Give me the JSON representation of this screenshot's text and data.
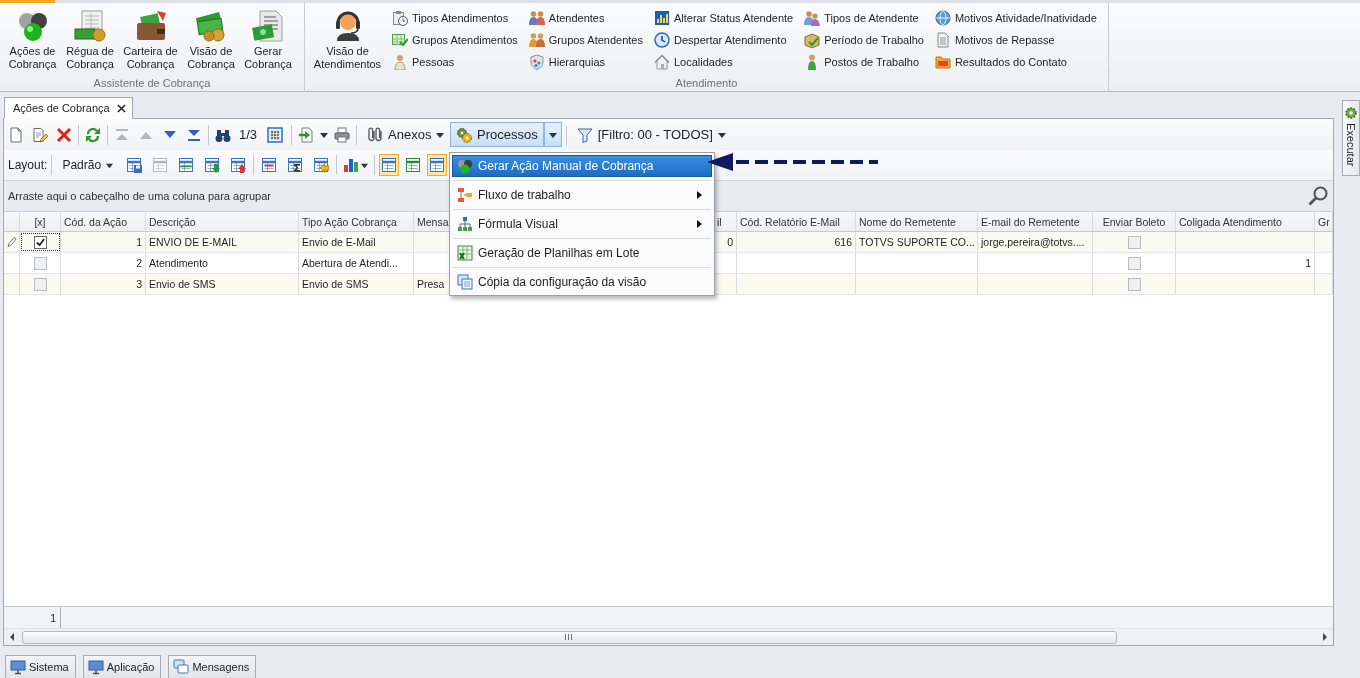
{
  "ribbon": {
    "groups": [
      {
        "label": "Assistente de Cobrança",
        "large_buttons": [
          "Ações de Cobrança",
          "Régua de Cobrança",
          "Carteira de Cobrança",
          "Visão de Cobrança",
          "Gerar Cobrança"
        ]
      },
      {
        "label": "Atendimento",
        "large_buttons": [
          "Visão de Atendimentos"
        ],
        "small_button_columns": [
          [
            "Tipos Atendimentos",
            "Grupos Atendimentos",
            "Pessoas"
          ],
          [
            "Atendentes",
            "Grupos Atendentes",
            "Hierarquias"
          ],
          [
            "Alterar Status Atendente",
            "Despertar Atendimento",
            "Localidades"
          ],
          [
            "Tipos de Atendente",
            "Período de Trabalho",
            "Postos de Trabalho"
          ],
          [
            "Motivos Atividade/Inatividade",
            "Motivos de Repasse",
            "Resultados do Contato"
          ]
        ]
      }
    ]
  },
  "document_tabs": [
    {
      "label": "Ações de Cobrança",
      "selected": true
    }
  ],
  "side_panel_tab": {
    "label": "Executar"
  },
  "toolbar": {
    "navigation": [
      {
        "disabled": true
      },
      {
        "disabled": true
      },
      {
        "disabled": false
      },
      {
        "disabled": false
      }
    ],
    "record_position": "1/3",
    "attachments_button": "Anexos",
    "processes_button": {
      "label": "Processos",
      "pressed": true
    },
    "filter_button": "[Filtro: 00 - TODOS]"
  },
  "layout_bar": {
    "label": "Layout:",
    "layout_dropdown": "Padrão",
    "tools": [
      {
        "disabled": false
      },
      {
        "disabled": true
      },
      {
        "disabled": false
      },
      {
        "disabled": false
      },
      {
        "disabled": false
      },
      {
        "disabled": false
      },
      {
        "disabled": false
      },
      {
        "disabled": false
      }
    ],
    "view_toggles": [
      {
        "pressed": true
      },
      {
        "pressed": false
      },
      {
        "pressed": true
      }
    ]
  },
  "processes_menu": {
    "items": [
      {
        "label": "Gerar Ação Manual de Cobrança",
        "selected": true,
        "submenu": false
      },
      {
        "label": "Fluxo de trabalho",
        "selected": false,
        "submenu": true
      },
      {
        "label": "Fórmula Visual",
        "selected": false,
        "submenu": true
      },
      {
        "label": "Geração de Planilhas em Lote",
        "selected": false,
        "submenu": false
      },
      {
        "label": "Cópia da configuração da visão",
        "selected": false,
        "submenu": false
      }
    ]
  },
  "annotation": {
    "kind": "dashed_arrow"
  },
  "group_panel": {
    "hint": "Arraste aqui o cabeçalho de uma coluna para agrupar"
  },
  "table": {
    "columns": [
      {
        "label": "[x]",
        "kind": "check"
      },
      {
        "label": "Cód. da Ação",
        "kind": "number"
      },
      {
        "label": "Descrição",
        "kind": "text"
      },
      {
        "label": "Tipo Ação Cobrança",
        "kind": "text"
      },
      {
        "label": "Mensa",
        "kind": "text"
      },
      {
        "label": "il",
        "kind": "number"
      },
      {
        "label": "Cód. Relatório E-Mail",
        "kind": "number"
      },
      {
        "label": "Nome do Remetente",
        "kind": "text"
      },
      {
        "label": "E-mail do Remetente",
        "kind": "text"
      },
      {
        "label": "Enviar Boleto",
        "kind": "check"
      },
      {
        "label": "Coligada Atendimento",
        "kind": "number"
      },
      {
        "label": "Gr",
        "kind": "text"
      }
    ],
    "rows": [
      {
        "current": true,
        "cells": [
          {
            "checked": true
          },
          "1",
          "ENVIO DE E-MAIL",
          "Envio de E-Mail",
          null,
          "0",
          "616",
          "TOTVS SUPORTE CO...",
          "jorge.pereira@totvs....",
          {
            "checked": false
          },
          null,
          null
        ]
      },
      {
        "current": false,
        "cells": [
          {
            "checked": false
          },
          "2",
          "Atendimento",
          "Abertura de Atendi...",
          null,
          null,
          null,
          null,
          null,
          {
            "checked": false
          },
          "1",
          null
        ]
      },
      {
        "current": false,
        "cells": [
          {
            "checked": false
          },
          "3",
          "Envio de SMS",
          "Envio de SMS",
          "Presa",
          null,
          null,
          null,
          null,
          {
            "checked": false
          },
          null,
          null
        ]
      }
    ],
    "footer": {
      "count": "1"
    }
  },
  "bottom_tabs": [
    {
      "label": "Sistema"
    },
    {
      "label": "Aplicação"
    },
    {
      "label": "Mensagens"
    }
  ]
}
